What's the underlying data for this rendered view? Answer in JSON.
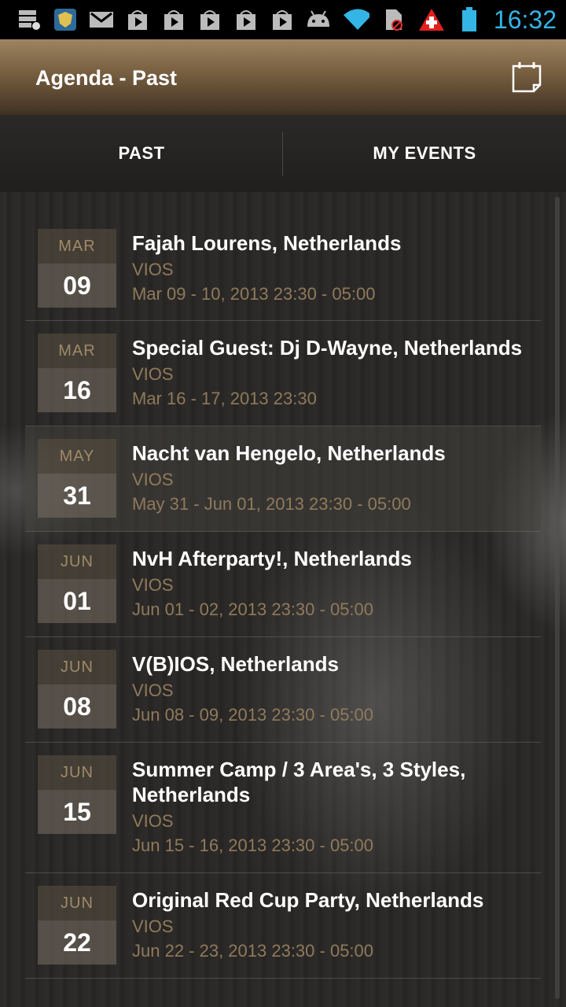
{
  "status_bar": {
    "time": "16:32",
    "icons": [
      "storage-icon",
      "shield-app-icon",
      "gmail-icon",
      "shopping-bag-icon",
      "shopping-bag-icon",
      "shopping-bag-icon",
      "shopping-bag-icon",
      "shopping-bag-icon",
      "android-icon",
      "wifi-icon",
      "no-sim-icon",
      "swiss-app-icon",
      "battery-icon"
    ]
  },
  "header": {
    "title": "Agenda - Past"
  },
  "tabs": [
    "PAST",
    "MY EVENTS"
  ],
  "colors": {
    "accent_blue": "#33b5e5",
    "gold": "#8f7a5b",
    "header_brown": "#7a6243"
  },
  "events": [
    {
      "month": "MAR",
      "day": "09",
      "title": "Fajah Lourens, Netherlands",
      "venue": "VIOS",
      "time": "Mar 09 - 10, 2013 23:30 - 05:00"
    },
    {
      "month": "MAR",
      "day": "16",
      "title": "Special Guest: Dj D-Wayne, Netherlands",
      "venue": "VIOS",
      "time": "Mar 16 - 17, 2013 23:30"
    },
    {
      "month": "MAY",
      "day": "31",
      "title": "Nacht van Hengelo, Netherlands",
      "venue": "VIOS",
      "time": "May 31 - Jun 01, 2013 23:30 - 05:00"
    },
    {
      "month": "JUN",
      "day": "01",
      "title": "NvH Afterparty!, Netherlands",
      "venue": "VIOS",
      "time": "Jun 01 - 02, 2013 23:30 - 05:00"
    },
    {
      "month": "JUN",
      "day": "08",
      "title": "V(B)IOS, Netherlands",
      "venue": "VIOS",
      "time": "Jun 08 - 09, 2013 23:30 - 05:00"
    },
    {
      "month": "JUN",
      "day": "15",
      "title": "Summer Camp / 3 Area's, 3 Styles, Netherlands",
      "venue": "VIOS",
      "time": "Jun 15 - 16, 2013 23:30 - 05:00"
    },
    {
      "month": "JUN",
      "day": "22",
      "title": "Original Red Cup Party, Netherlands",
      "venue": "VIOS",
      "time": "Jun 22 - 23, 2013 23:30 - 05:00"
    }
  ]
}
